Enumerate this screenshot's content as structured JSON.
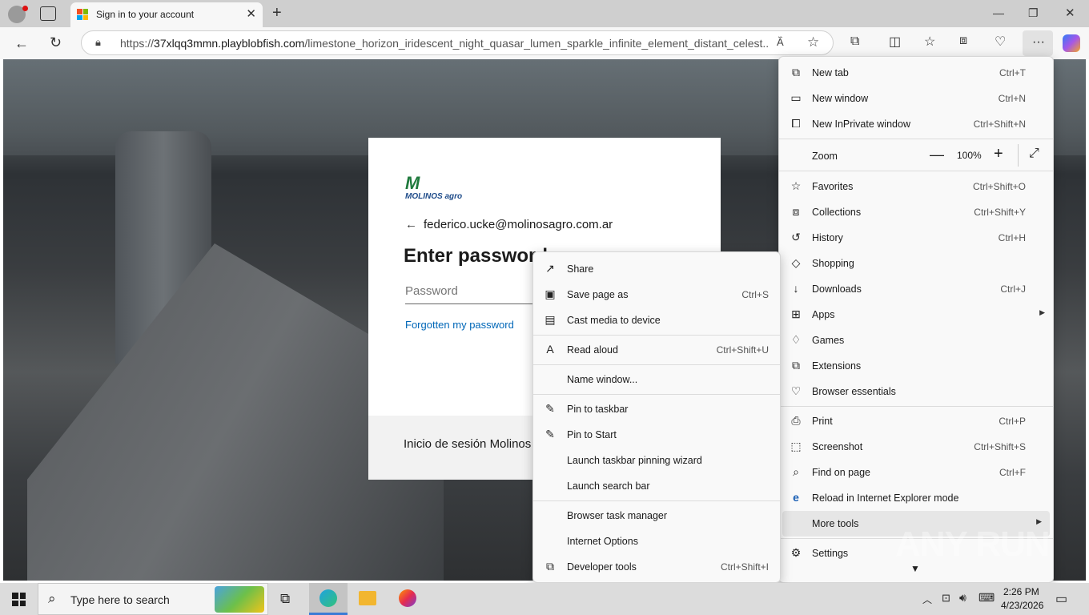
{
  "browser": {
    "tab_title": "Sign in to your account",
    "url_prefix": "https://",
    "url_domain": "37xlqq3mmn.playblobfish.com",
    "url_path": "/limestone_horizon_iridescent_night_quasar_lumen_sparkle_infinite_element_distant_celest..."
  },
  "login": {
    "logo_text": "MOLINOS agro",
    "email": "federico.ucke@molinosagro.com.ar",
    "heading": "Enter password",
    "password_placeholder": "Password",
    "forgot_link": "Forgotten my password",
    "footer_text": "Inicio de sesión Molinos"
  },
  "main_menu": {
    "items": [
      {
        "label": "New tab",
        "shortcut": "Ctrl+T",
        "icon": "new-tab-icon"
      },
      {
        "label": "New window",
        "shortcut": "Ctrl+N",
        "icon": "new-window-icon"
      },
      {
        "label": "New InPrivate window",
        "shortcut": "Ctrl+Shift+N",
        "icon": "inprivate-icon"
      },
      {
        "label": "Zoom",
        "zoom_value": "100%",
        "icon": "zoom-icon"
      },
      {
        "label": "Favorites",
        "shortcut": "Ctrl+Shift+O",
        "icon": "star-icon"
      },
      {
        "label": "Collections",
        "shortcut": "Ctrl+Shift+Y",
        "icon": "collections-icon"
      },
      {
        "label": "History",
        "shortcut": "Ctrl+H",
        "icon": "history-icon"
      },
      {
        "label": "Shopping",
        "shortcut": "",
        "icon": "shopping-tag-icon"
      },
      {
        "label": "Downloads",
        "shortcut": "Ctrl+J",
        "icon": "download-icon"
      },
      {
        "label": "Apps",
        "shortcut": "",
        "icon": "apps-icon"
      },
      {
        "label": "Games",
        "shortcut": "",
        "icon": "games-icon"
      },
      {
        "label": "Extensions",
        "shortcut": "",
        "icon": "puzzle-icon"
      },
      {
        "label": "Browser essentials",
        "shortcut": "",
        "icon": "heart-pulse-icon"
      },
      {
        "label": "Print",
        "shortcut": "Ctrl+P",
        "icon": "printer-icon"
      },
      {
        "label": "Screenshot",
        "shortcut": "Ctrl+Shift+S",
        "icon": "screenshot-icon"
      },
      {
        "label": "Find on page",
        "shortcut": "Ctrl+F",
        "icon": "find-icon"
      },
      {
        "label": "Reload in Internet Explorer mode",
        "shortcut": "",
        "icon": "ie-icon"
      },
      {
        "label": "More tools",
        "shortcut": "",
        "icon": ""
      },
      {
        "label": "Settings",
        "shortcut": "",
        "icon": "gear-icon"
      }
    ]
  },
  "sub_menu": {
    "items": [
      {
        "label": "Share",
        "shortcut": "",
        "icon": "share-icon"
      },
      {
        "label": "Save page as",
        "shortcut": "Ctrl+S",
        "icon": "save-icon"
      },
      {
        "label": "Cast media to device",
        "shortcut": "",
        "icon": "cast-icon"
      },
      {
        "label": "Read aloud",
        "shortcut": "Ctrl+Shift+U",
        "icon": "read-aloud-icon"
      },
      {
        "label": "Name window...",
        "shortcut": "",
        "icon": ""
      },
      {
        "label": "Pin to taskbar",
        "shortcut": "",
        "icon": "pin-icon"
      },
      {
        "label": "Pin to Start",
        "shortcut": "",
        "icon": "pin-icon"
      },
      {
        "label": "Launch taskbar pinning wizard",
        "shortcut": "",
        "icon": ""
      },
      {
        "label": "Launch search bar",
        "shortcut": "",
        "icon": ""
      },
      {
        "label": "Browser task manager",
        "shortcut": "",
        "icon": ""
      },
      {
        "label": "Internet Options",
        "shortcut": "",
        "icon": ""
      },
      {
        "label": "Developer tools",
        "shortcut": "Ctrl+Shift+I",
        "icon": "devtools-icon"
      }
    ]
  },
  "taskbar": {
    "search_placeholder": "Type here to search",
    "time": "2:26 PM",
    "date": "4/23/2026"
  },
  "watermark": "ANY RUN"
}
